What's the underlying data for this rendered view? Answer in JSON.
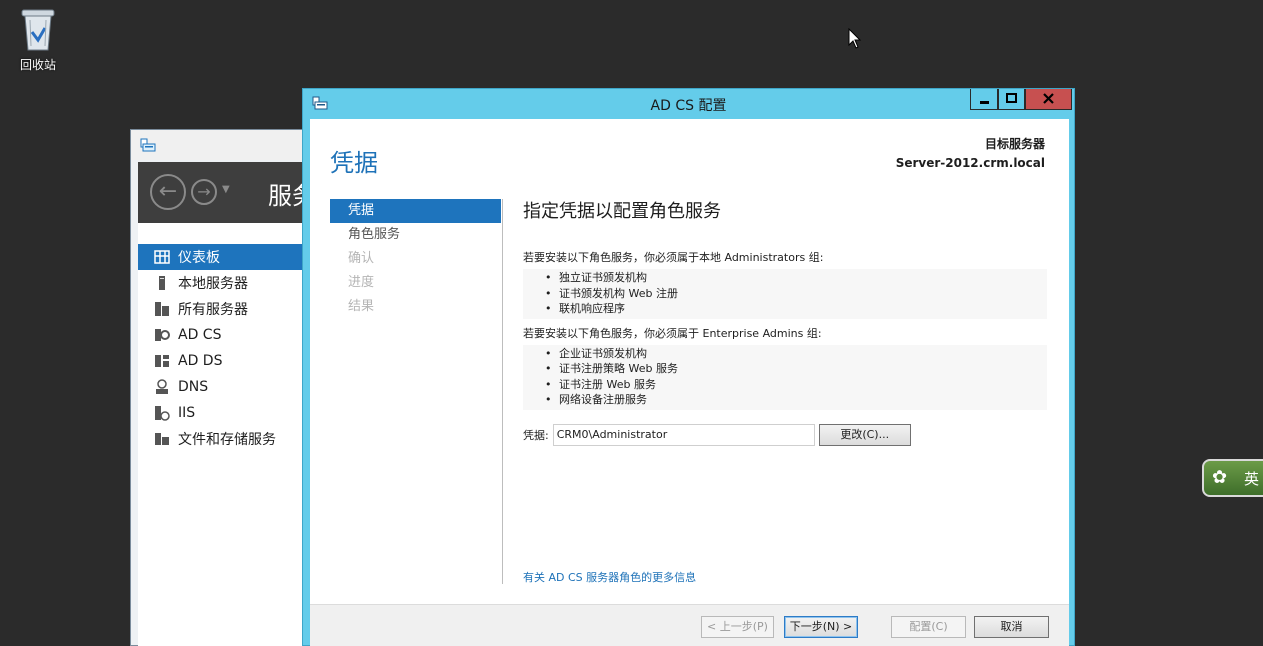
{
  "desktop": {
    "recycle_bin_label": "回收站"
  },
  "server_manager": {
    "title": "服务",
    "sidebar": [
      {
        "label": "仪表板",
        "icon": "dashboard-icon",
        "selected": true
      },
      {
        "label": "本地服务器",
        "icon": "server-icon"
      },
      {
        "label": "所有服务器",
        "icon": "servers-icon"
      },
      {
        "label": "AD CS",
        "icon": "adcs-icon"
      },
      {
        "label": "AD DS",
        "icon": "adds-icon"
      },
      {
        "label": "DNS",
        "icon": "dns-icon"
      },
      {
        "label": "IIS",
        "icon": "iis-icon"
      },
      {
        "label": "文件和存储服务",
        "icon": "storage-icon"
      }
    ]
  },
  "dialog": {
    "title": "AD CS 配置",
    "page_title": "凭据",
    "target_label": "目标服务器",
    "target_value": "Server-2012.crm.local",
    "steps": [
      {
        "label": "凭据",
        "state": "selected"
      },
      {
        "label": "角色服务",
        "state": "normal"
      },
      {
        "label": "确认",
        "state": "disabled"
      },
      {
        "label": "进度",
        "state": "disabled"
      },
      {
        "label": "结果",
        "state": "disabled"
      }
    ],
    "heading": "指定凭据以配置角色服务",
    "local_admin_text": "若要安装以下角色服务，你必须属于本地 Administrators 组:",
    "local_admin_items": [
      "独立证书颁发机构",
      "证书颁发机构 Web 注册",
      "联机响应程序"
    ],
    "enterprise_admin_text": "若要安装以下角色服务，你必须属于 Enterprise Admins 组:",
    "enterprise_admin_items": [
      "企业证书颁发机构",
      "证书注册策略 Web 服务",
      "证书注册 Web 服务",
      "网络设备注册服务"
    ],
    "credential_label": "凭据:",
    "credential_value": "CRM0\\Administrator",
    "change_button": "更改(C)...",
    "more_info_link": "有关 AD CS 服务器角色的更多信息",
    "buttons": {
      "prev": "< 上一步(P)",
      "next": "下一步(N) >",
      "configure": "配置(C)",
      "cancel": "取消"
    }
  },
  "ime": {
    "label": "英"
  },
  "colors": {
    "accent": "#1e74bd",
    "caption": "#64ccea",
    "close": "#c75050"
  }
}
